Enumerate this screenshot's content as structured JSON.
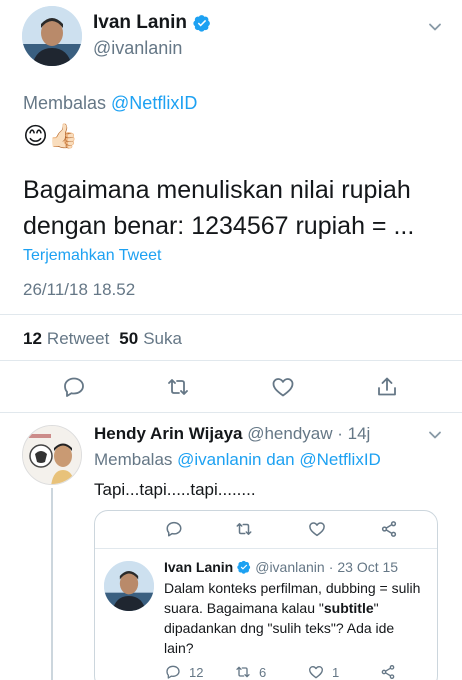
{
  "main_tweet": {
    "author_name": "Ivan Lanin",
    "author_handle": "@ivanlanin",
    "replying_prefix": "Membalas ",
    "replying_to": "@NetflixID",
    "emojis": "😊👍🏻",
    "text": "Bagaimana menuliskan nilai rupiah dengan benar: 1234567 rupiah = ...",
    "translate_label": "Terjemahkan Tweet",
    "timestamp": "26/11/18 18.52",
    "retweet_count": "12",
    "retweet_label": "Retweet",
    "like_count": "50",
    "like_label": "Suka"
  },
  "reply": {
    "author_name": "Hendy Arin Wijaya",
    "author_handle": "@hendyaw",
    "separator": " · ",
    "time": "14j",
    "replying_prefix": "Membalas ",
    "replying_to_1": "@ivanlanin",
    "replying_and": " dan ",
    "replying_to_2": "@NetflixID",
    "text": "Tapi...tapi.....tapi........"
  },
  "quoted": {
    "author_name": "Ivan Lanin",
    "author_handle": "@ivanlanin",
    "separator": " · ",
    "date": "23 Oct 15",
    "text_1": "Dalam konteks perfilman, dubbing = sulih suara. Bagaimana kalau \"",
    "text_bold": "subtitle",
    "text_2": "\" dipadankan dng \"sulih teks\"? Ada ide lain?",
    "reply_count": "12",
    "retweet_count": "6",
    "like_count": "1"
  },
  "colors": {
    "accent": "#1da1f2",
    "secondary_text": "#657786",
    "divider": "#e1e8ed"
  },
  "icons": [
    "verified-badge-icon",
    "chevron-down-icon",
    "reply-icon",
    "retweet-icon",
    "like-icon",
    "share-icon"
  ]
}
